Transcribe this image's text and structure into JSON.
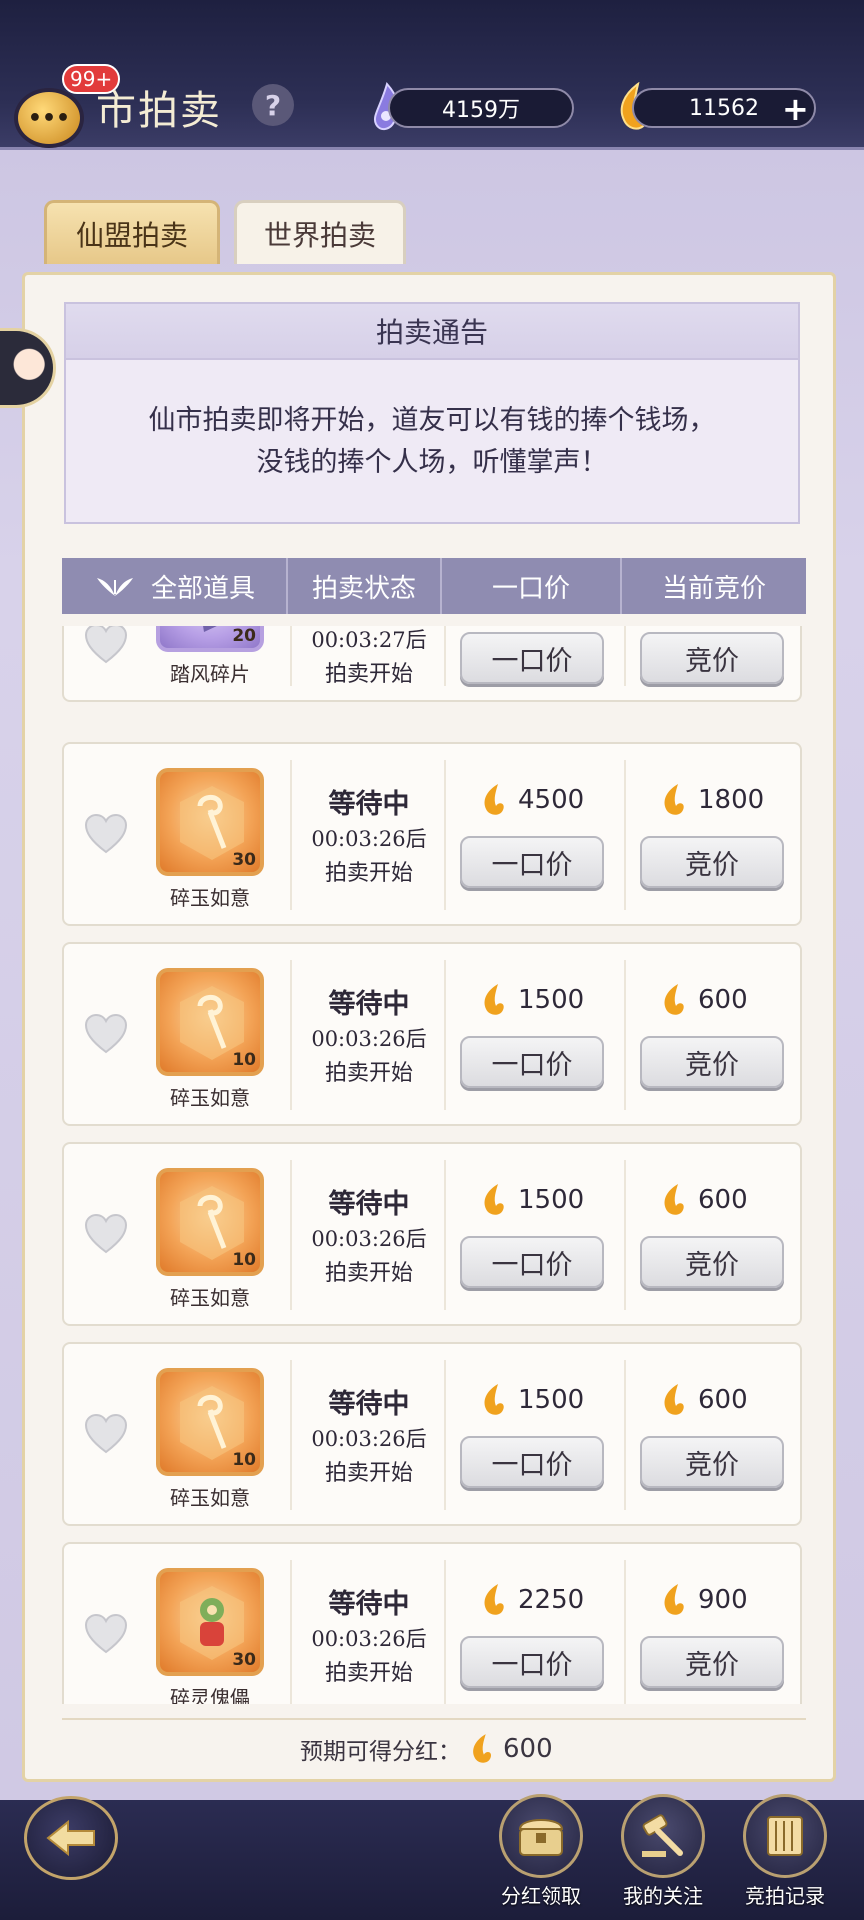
{
  "header": {
    "title": "市拍卖",
    "chat_badge": "99+",
    "jade_amount": "4159万",
    "gold_amount": "11562",
    "chat_icon": "chat-bubble-icon",
    "help_icon": "question-icon"
  },
  "tabs": [
    {
      "label": "仙盟拍卖",
      "active": true
    },
    {
      "label": "世界拍卖",
      "active": false
    }
  ],
  "notice": {
    "title": "拍卖通告",
    "line1": "仙市拍卖即将开始，道友可以有钱的捧个钱场，",
    "line2": "没钱的捧个人场，听懂掌声！"
  },
  "table_headers": {
    "items": "全部道具",
    "status": "拍卖状态",
    "buyout": "一口价",
    "current_bid": "当前竞价"
  },
  "rows": [
    {
      "name": "踏风碎片",
      "count": "20",
      "status": "",
      "time": "00:03:27后",
      "start": "拍卖开始",
      "buyout": "",
      "bid": "",
      "buy_label": "一口价",
      "bid_label": "竞价"
    },
    {
      "name": "碎玉如意",
      "count": "30",
      "status": "等待中",
      "time": "00:03:26后",
      "start": "拍卖开始",
      "buyout": "4500",
      "bid": "1800",
      "buy_label": "一口价",
      "bid_label": "竞价"
    },
    {
      "name": "碎玉如意",
      "count": "10",
      "status": "等待中",
      "time": "00:03:26后",
      "start": "拍卖开始",
      "buyout": "1500",
      "bid": "600",
      "buy_label": "一口价",
      "bid_label": "竞价"
    },
    {
      "name": "碎玉如意",
      "count": "10",
      "status": "等待中",
      "time": "00:03:26后",
      "start": "拍卖开始",
      "buyout": "1500",
      "bid": "600",
      "buy_label": "一口价",
      "bid_label": "竞价"
    },
    {
      "name": "碎玉如意",
      "count": "10",
      "status": "等待中",
      "time": "00:03:26后",
      "start": "拍卖开始",
      "buyout": "1500",
      "bid": "600",
      "buy_label": "一口价",
      "bid_label": "竞价"
    },
    {
      "name": "碎灵傀儡",
      "count": "30",
      "status": "等待中",
      "time": "00:03:26后",
      "start": "拍卖开始",
      "buyout": "2250",
      "bid": "900",
      "buy_label": "一口价",
      "bid_label": "竞价"
    }
  ],
  "footer": {
    "dividend_label": "预期可得分红：",
    "dividend_value": "600"
  },
  "bottom_nav": {
    "dividend_claim": "分红领取",
    "my_watch": "我的关注",
    "bid_record": "竞拍记录"
  },
  "colors": {
    "header_bg": "#1e2040",
    "table_head": "#8f8cb1",
    "gold": "#f0a21e",
    "tab_active": "#f6e2b0"
  }
}
